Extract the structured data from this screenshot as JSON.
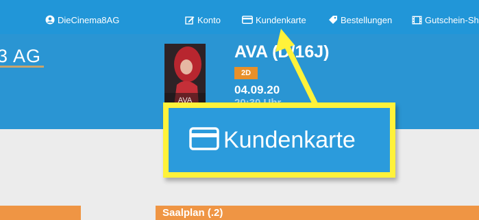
{
  "nav": {
    "user_label": "DieCinema8AG",
    "konto_label": "Konto",
    "karte_label": "Kundenkarte",
    "orders_label": "Bestellungen",
    "voucher_label": "Gutschein-Sh"
  },
  "hero": {
    "brand_partial": "3 AG",
    "poster_title": "AVA",
    "movie_title": "AVA (D/16J)",
    "format_badge": "2D",
    "date": "04.09.20",
    "time": "20:30 Uhr"
  },
  "content": {
    "saalplan_label": "Saalplan (.2)"
  },
  "callout": {
    "label": "Kundenkarte"
  },
  "colors": {
    "nav_blue": "#2196d8",
    "hero_blue": "#2a95d3",
    "badge_orange": "#e8902a",
    "section_orange": "#ef9544",
    "highlight_yellow": "#fff23a",
    "brand_underline": "#c9a46b"
  },
  "icons": {
    "user": "user-circle-icon",
    "konto": "edit-icon",
    "karte": "card-icon",
    "orders": "tag-icon",
    "voucher": "film-icon",
    "arrow": "pointer-arrow"
  }
}
